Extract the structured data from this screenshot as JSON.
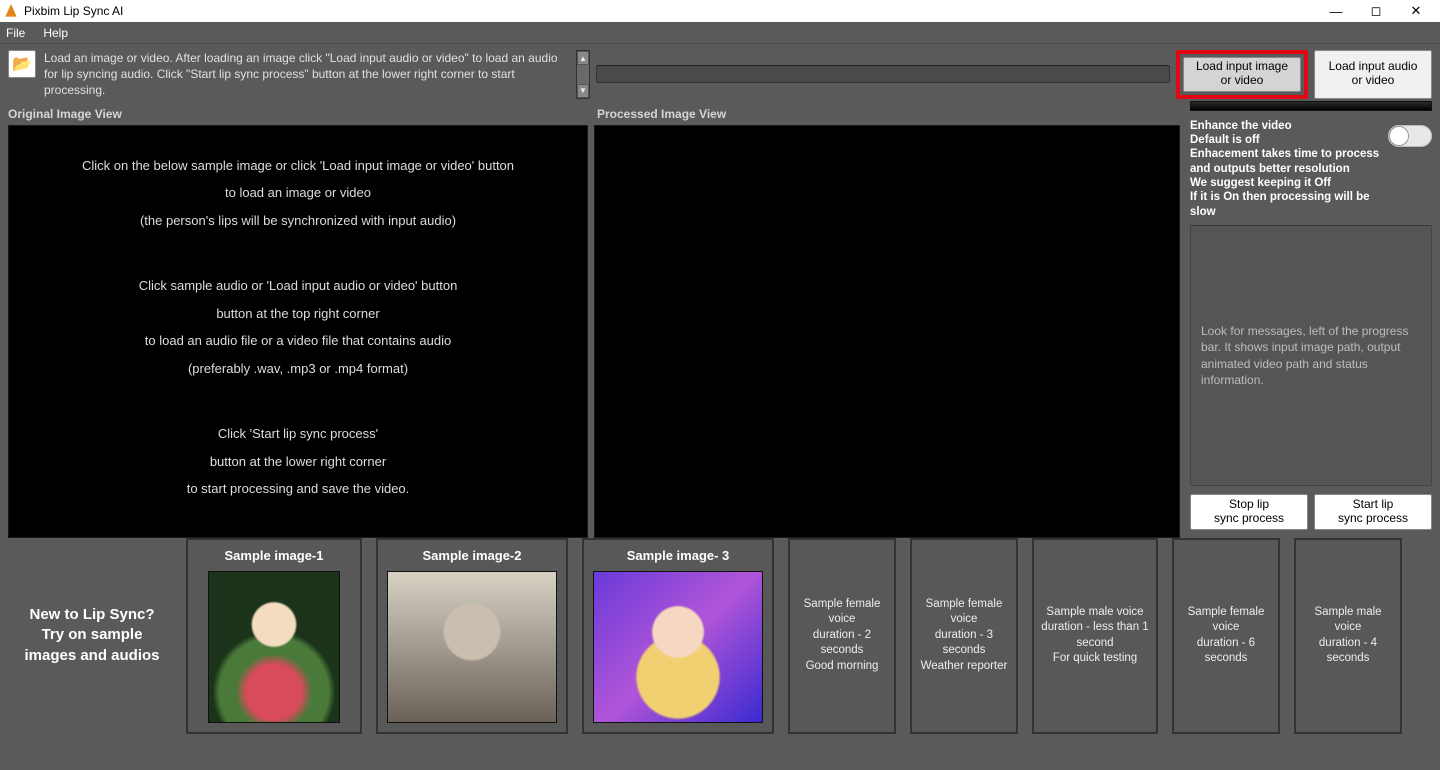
{
  "titlebar": {
    "title": "Pixbim Lip Sync AI"
  },
  "menubar": {
    "file": "File",
    "help": "Help"
  },
  "topstrip": {
    "hint": "Load an image or video. After loading an image click \"Load input audio or video\" to load an audio for lip syncing audio. Click \"Start lip sync process\" button at the lower right corner to start processing.",
    "load_image_l1": "Load input image",
    "load_image_l2": "or video",
    "load_audio_l1": "Load input audio",
    "load_audio_l2": "or video",
    "path_value": ""
  },
  "views": {
    "original_header": "Original Image View",
    "processed_header": "Processed Image View",
    "instructions": {
      "b1l1": "Click on the below sample image or click 'Load input image or video' button",
      "b1l2": "to load an image or video",
      "b1l3": "(the person's lips will be synchronized with input audio)",
      "b2l1": "Click sample audio or 'Load input audio or video' button",
      "b2l2": "button at the top right corner",
      "b2l3": "to load an audio file or a video file that contains audio",
      "b2l4": "(preferably .wav, .mp3 or .mp4 format)",
      "b3l1": "Click 'Start lip sync process'",
      "b3l2": "button at the lower right corner",
      "b3l3": "to start processing and save the video."
    }
  },
  "side": {
    "enhance_title": "Enhance the video",
    "enhance_l1": "Default is off",
    "enhance_l2": "Enhacement takes time to process and outputs better resolution",
    "enhance_l3": "We suggest keeping it Off",
    "enhance_l4": "If it is On then processing will be slow",
    "msg_box": "Look for messages, left of the progress bar. It shows input image path, output animated video path and status information.",
    "stop_l1": "Stop lip",
    "stop_l2": "sync process",
    "start_l1": "Start lip",
    "start_l2": "sync process"
  },
  "bottom": {
    "intro_l1": "New to Lip Sync?",
    "intro_l2": "Try on sample images and audios",
    "samples": {
      "img1": "Sample image-1",
      "img2": "Sample image-2",
      "img3": "Sample image- 3",
      "a1l1": "Sample female voice",
      "a1l2": "duration - 2 seconds",
      "a1l3": "Good morning",
      "a2l1": "Sample female voice",
      "a2l2": "duration - 3 seconds",
      "a2l3": "Weather reporter",
      "a3l1": "Sample male voice",
      "a3l2": "duration - less than 1 second",
      "a3l3": "For quick testing",
      "a4l1": "Sample female voice",
      "a4l2": "duration - 6 seconds",
      "a5l1": "Sample male voice",
      "a5l2": "duration - 4 seconds"
    }
  }
}
